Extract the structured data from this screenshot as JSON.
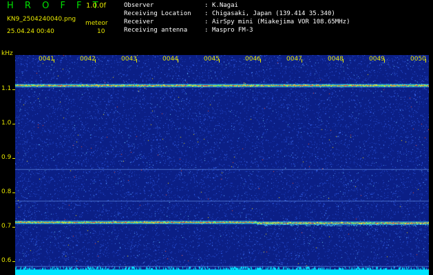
{
  "header": {
    "app_title": "H R O F F T",
    "version": "1.0.0f",
    "file_name": "KN9_2504240040.png",
    "timestamp": "25.04.24 00:40",
    "mode_label": "meteor",
    "mode_value": "10"
  },
  "info": [
    {
      "label": "Observer",
      "separator": ":",
      "value": "K.Nagai"
    },
    {
      "label": "Receiving Location",
      "separator": ":",
      "value": "Chigasaki, Japan (139.414 35.340)"
    },
    {
      "label": "Receiver",
      "separator": ":",
      "value": "AirSpy mini (Miakejima VOR 108.65MHz)"
    },
    {
      "label": "Receiving antenna",
      "separator": ":",
      "value": "Maspro FM-3"
    }
  ],
  "axis": {
    "y_unit": "kHz",
    "y_ticks": [
      "1.1",
      "1.0",
      "0.9",
      "0.8",
      "0.7",
      "0.6"
    ],
    "x_ticks": [
      "0041",
      "0042",
      "0043",
      "0044",
      "0045",
      "0046",
      "0047",
      "0048",
      "0049",
      "0050"
    ]
  },
  "colors": {
    "background": "#000000",
    "label": "#e8e800",
    "title": "#00e000",
    "info_text": "#ffffff",
    "spectrum_base": "#0b1f86",
    "noise_floor": "#00e5ff"
  },
  "spectrum": {
    "y_range_khz": [
      0.58,
      1.18
    ],
    "carrier_lines_khz": [
      1.097,
      0.725
    ],
    "faint_lines_khz": [
      0.868,
      0.782,
      0.604
    ]
  }
}
